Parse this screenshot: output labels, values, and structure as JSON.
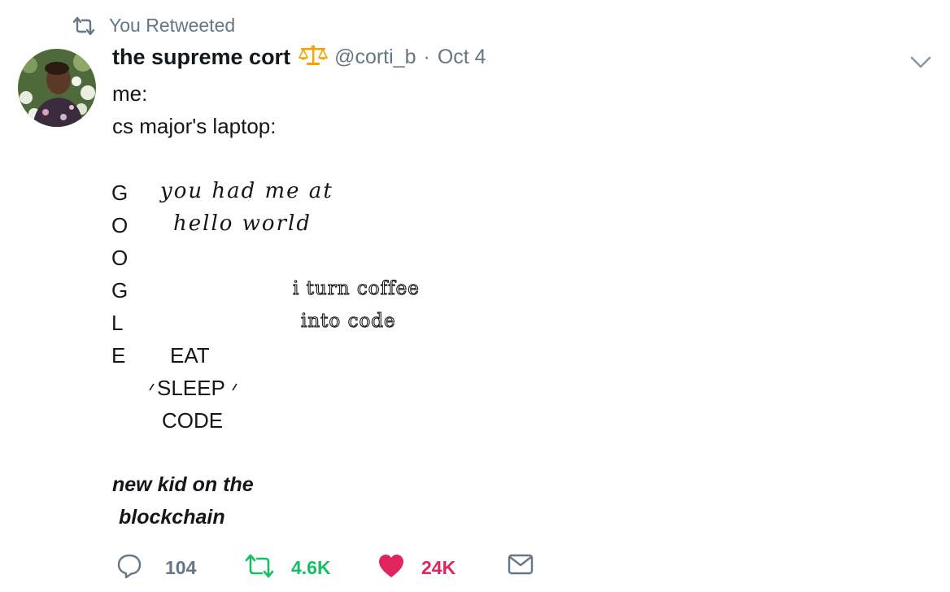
{
  "retweet_context": {
    "label": "You Retweeted",
    "icon": "retweet-icon"
  },
  "author": {
    "display_name": "the supreme cort",
    "badge_icon": "scales-emoji-icon",
    "handle": "@corti_b",
    "separator": "·",
    "date": "Oct 4"
  },
  "tweet": {
    "lines": [
      "me:",
      "cs major's laptop:"
    ],
    "stickers": {
      "google_letters": [
        "G",
        "O",
        "O",
        "G",
        "L",
        "E"
      ],
      "script_line1": "you had me at",
      "script_line2": "hello world",
      "coffee_line1": "i turn coffee",
      "coffee_line2": "into code",
      "eat": "EAT",
      "sleep": "SLEEP",
      "code": "CODE",
      "blockchain_line1": "new kid on the",
      "blockchain_line2": "blockchain"
    }
  },
  "actions": {
    "reply_count": "104",
    "retweet_count": "4.6K",
    "like_count": "24K",
    "colors": {
      "reply": "#657786",
      "retweet": "#17bf63",
      "like": "#e0245e",
      "dm": "#657786"
    }
  }
}
